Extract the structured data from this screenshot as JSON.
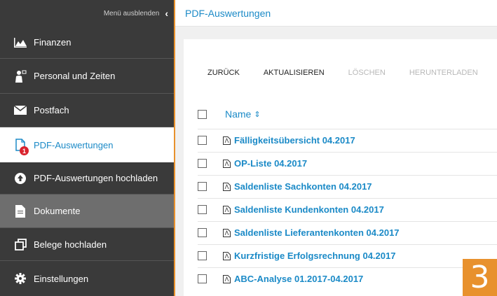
{
  "sidebar": {
    "hide_menu_label": "Menü ausblenden",
    "items": [
      {
        "label": "Finanzen",
        "icon": "chart-icon"
      },
      {
        "label": "Personal und Zeiten",
        "icon": "person-icon"
      },
      {
        "label": "Postfach",
        "icon": "mail-icon"
      },
      {
        "label": "PDF-Auswertungen",
        "icon": "pdf-file-icon",
        "badge": "1"
      },
      {
        "label": "PDF-Auswertungen hochladen",
        "icon": "upload-icon"
      },
      {
        "label": "Dokumente",
        "icon": "document-icon"
      },
      {
        "label": "Belege hochladen",
        "icon": "copy-icon"
      },
      {
        "label": "Einstellungen",
        "icon": "gear-icon"
      }
    ]
  },
  "header": {
    "title": "PDF-Auswertungen"
  },
  "toolbar": {
    "back_label": "ZURÜCK",
    "refresh_label": "AKTUALISIEREN",
    "delete_label": "LÖSCHEN",
    "download_label": "HERUNTERLADEN"
  },
  "list": {
    "column_name": "Name",
    "files": [
      "Fälligkeitsübersicht 04.2017",
      "OP-Liste 04.2017",
      "Saldenliste Sachkonten 04.2017",
      "Saldenliste Kundenkonten 04.2017",
      "Saldenliste Lieferantenkonten 04.2017",
      "Kurzfristige Erfolgsrechnung 04.2017",
      "ABC-Analyse 01.2017-04.2017"
    ]
  },
  "step_badge": "3",
  "colors": {
    "accent": "#1b8ac7",
    "orange": "#e8912d",
    "sidebar": "#3a3a3a",
    "badge_red": "#d9232e"
  }
}
